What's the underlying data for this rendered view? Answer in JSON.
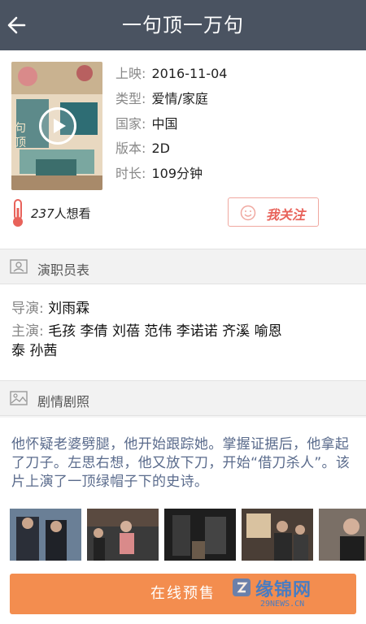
{
  "header": {
    "title": "一句顶一万句",
    "back_icon": "arrow-left-icon"
  },
  "movie": {
    "meta": [
      {
        "key": "上映",
        "value": "2016-11-04"
      },
      {
        "key": "类型",
        "value": "爱情/家庭"
      },
      {
        "key": "国家",
        "value": "中国"
      },
      {
        "key": "版本",
        "value": "2D"
      },
      {
        "key": "时长",
        "value": "109分钟"
      }
    ],
    "want_count": "237",
    "want_label": "人想看",
    "follow_label": "我关注"
  },
  "cast_section": {
    "title": "演职员表",
    "director_key": "导演",
    "director": "刘雨霖",
    "actors_key": "主演",
    "actors_line1": "毛孩 李倩 刘蓓 范伟 李诺诺 齐溪 喻恩",
    "actors_line2": "泰 孙茜"
  },
  "plot_section": {
    "title": "剧情剧照",
    "synopsis": "他怀疑老婆劈腿，他开始跟踪她。掌握证据后，他拿起了刀子。左思右想，他又放下刀，开始“借刀杀人”。该片上演了一顶绿帽子下的史诗。",
    "still_count": 5
  },
  "actions": {
    "presale_label": "在线预售"
  },
  "watermark": {
    "text": "缘锦网",
    "url": "29NEWS.CN"
  },
  "colors": {
    "header_bg": "#4a5361",
    "accent": "#e8625a",
    "button": "#f38d4f",
    "synopsis": "#5a6b8c"
  }
}
